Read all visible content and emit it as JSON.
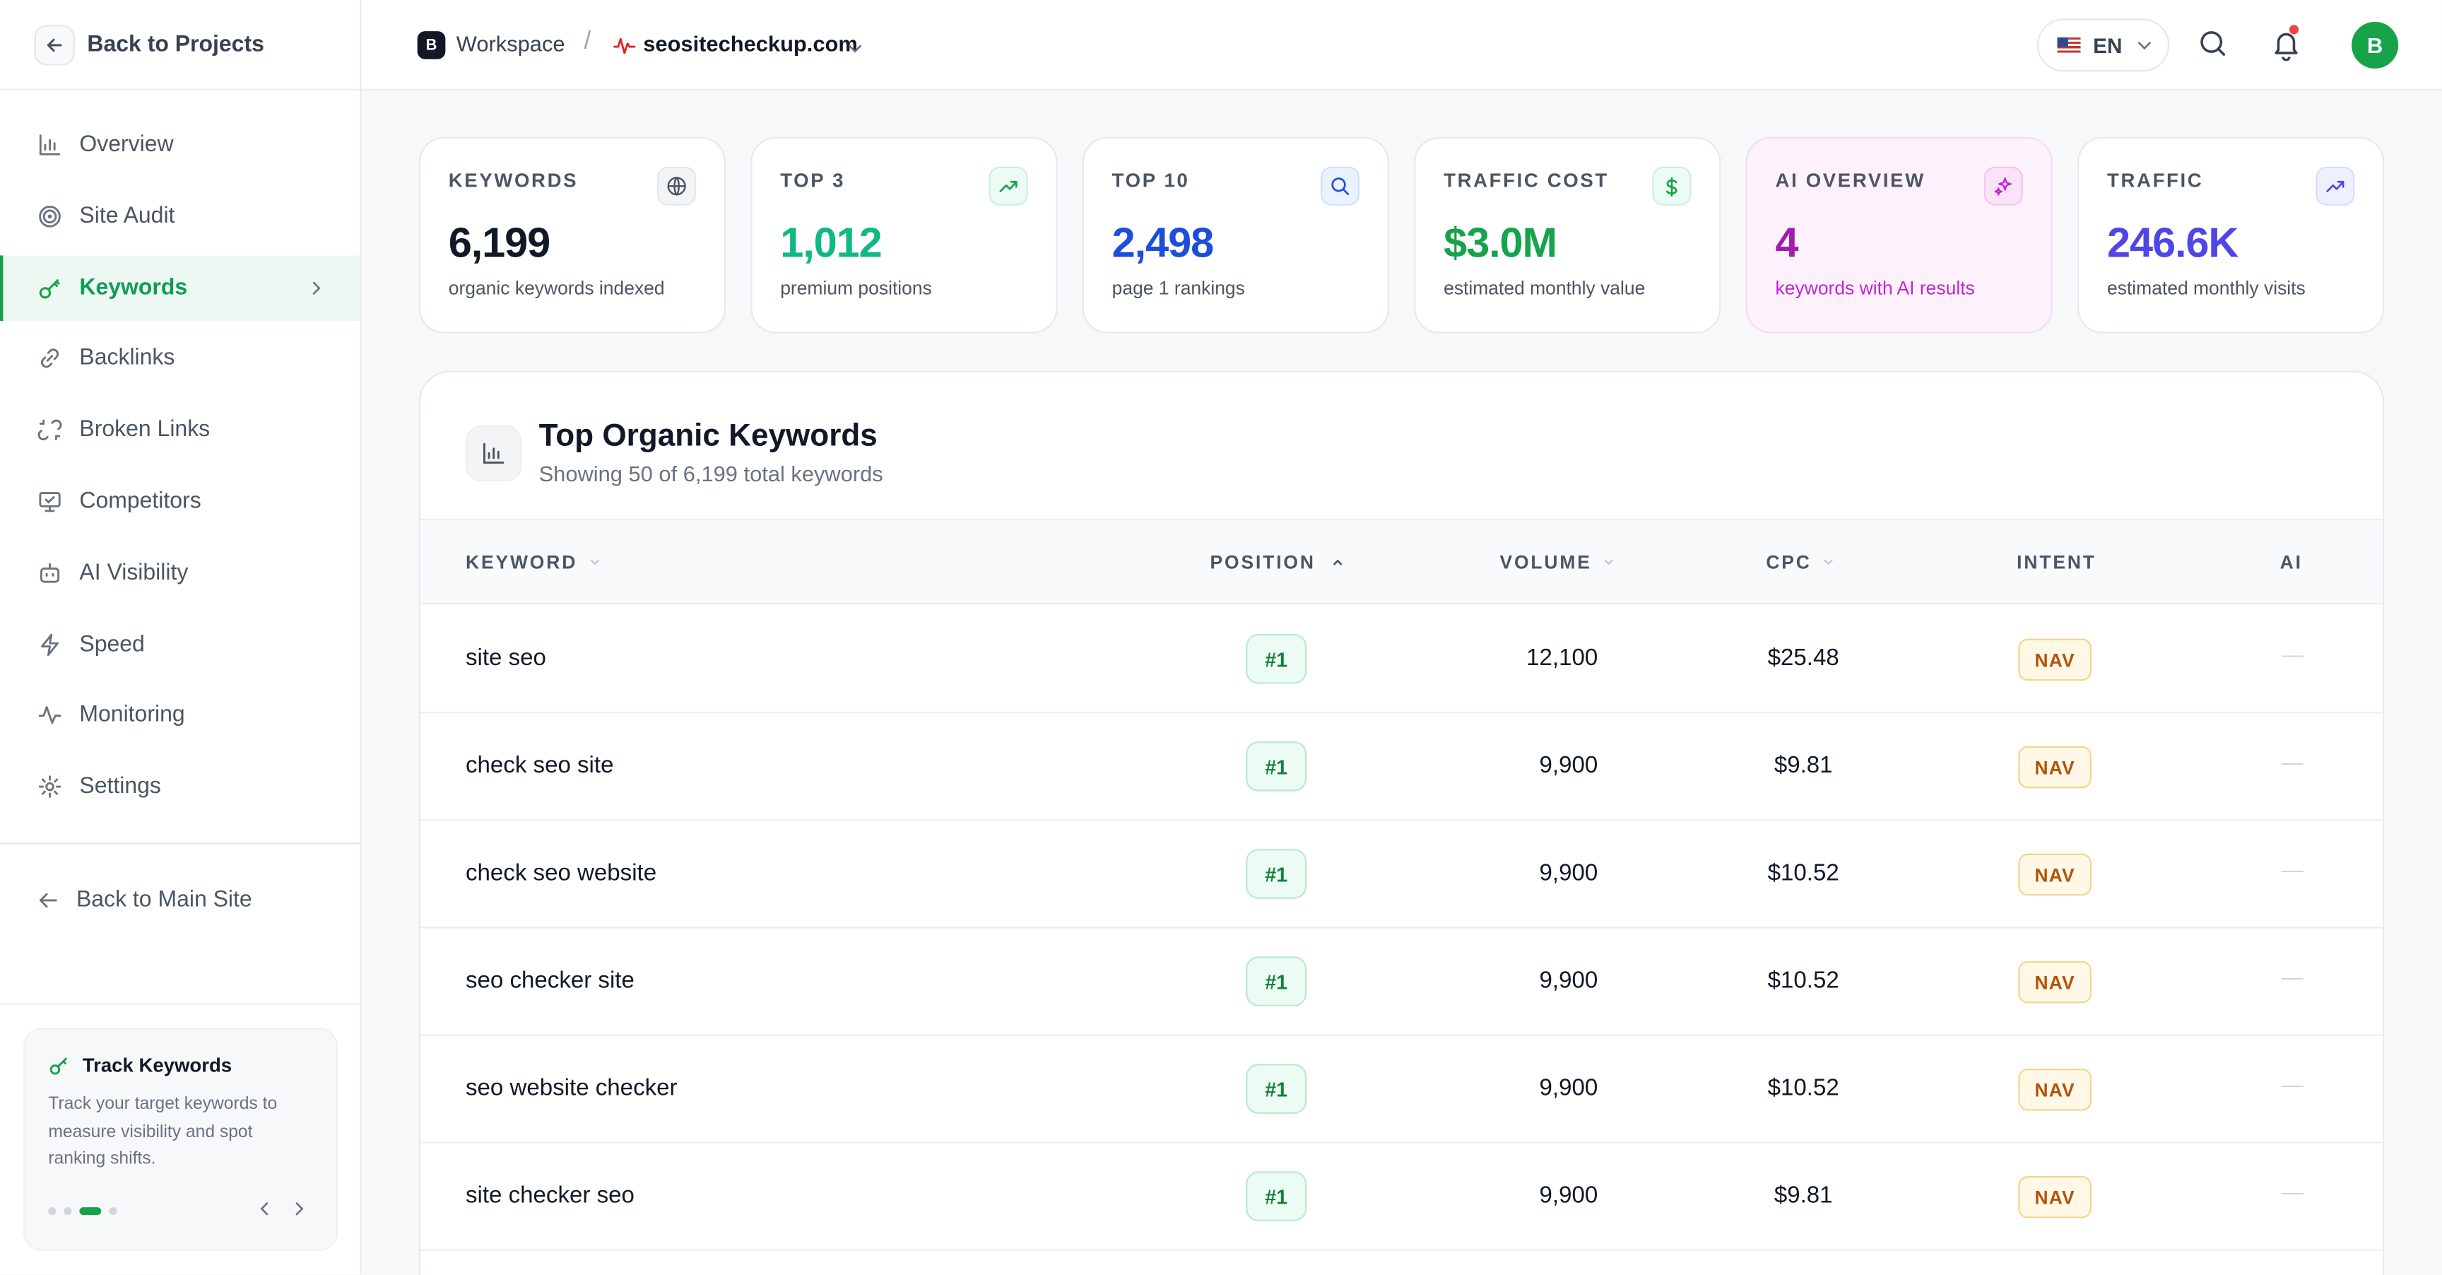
{
  "sidebar": {
    "back_projects": "Back to Projects",
    "items": [
      {
        "label": "Overview",
        "icon": "bar-chart-icon"
      },
      {
        "label": "Site Audit",
        "icon": "target-icon"
      },
      {
        "label": "Keywords",
        "icon": "key-icon",
        "active": true
      },
      {
        "label": "Backlinks",
        "icon": "link-icon"
      },
      {
        "label": "Broken Links",
        "icon": "broken-link-icon"
      },
      {
        "label": "Competitors",
        "icon": "monitor-icon"
      },
      {
        "label": "AI Visibility",
        "icon": "bot-icon"
      },
      {
        "label": "Speed",
        "icon": "lightning-icon"
      },
      {
        "label": "Monitoring",
        "icon": "activity-icon"
      },
      {
        "label": "Settings",
        "icon": "gear-icon"
      }
    ],
    "back_main": "Back to Main Site",
    "track_card": {
      "title": "Track Keywords",
      "body": "Track your target keywords to measure visibility and spot ranking shifts."
    }
  },
  "topbar": {
    "workspace_badge": "B",
    "workspace": "Workspace",
    "separator": "/",
    "site": "seositecheckup.com",
    "language": "EN",
    "avatar": "B"
  },
  "stats": [
    {
      "title": "KEYWORDS",
      "value": "6,199",
      "desc": "organic keywords indexed",
      "color": "#111827"
    },
    {
      "title": "TOP 3",
      "value": "1,012",
      "desc": "premium positions",
      "color": "#10b981"
    },
    {
      "title": "TOP 10",
      "value": "2,498",
      "desc": "page 1 rankings",
      "color": "#1d4ed8"
    },
    {
      "title": "TRAFFIC COST",
      "value": "$3.0M",
      "desc": "estimated monthly value",
      "color": "#16a34a"
    },
    {
      "title": "AI OVERVIEW",
      "value": "4",
      "desc": "keywords with AI results",
      "color": "#a21caf"
    },
    {
      "title": "TRAFFIC",
      "value": "246.6K",
      "desc": "estimated monthly visits",
      "color": "#4f46e5"
    }
  ],
  "table": {
    "title": "Top Organic Keywords",
    "subtitle": "Showing 50 of 6,199 total keywords",
    "columns": {
      "keyword": "KEYWORD",
      "position": "POSITION",
      "volume": "VOLUME",
      "cpc": "CPC",
      "intent": "INTENT",
      "ai": "AI"
    },
    "rows": [
      {
        "keyword": "site seo",
        "position": "#1",
        "volume": "12,100",
        "cpc": "$25.48",
        "intent": "NAV",
        "ai": "—"
      },
      {
        "keyword": "check seo site",
        "position": "#1",
        "volume": "9,900",
        "cpc": "$9.81",
        "intent": "NAV",
        "ai": "—"
      },
      {
        "keyword": "check seo website",
        "position": "#1",
        "volume": "9,900",
        "cpc": "$10.52",
        "intent": "NAV",
        "ai": "—"
      },
      {
        "keyword": "seo checker site",
        "position": "#1",
        "volume": "9,900",
        "cpc": "$10.52",
        "intent": "NAV",
        "ai": "—"
      },
      {
        "keyword": "seo website checker",
        "position": "#1",
        "volume": "9,900",
        "cpc": "$10.52",
        "intent": "NAV",
        "ai": "—"
      },
      {
        "keyword": "site checker seo",
        "position": "#1",
        "volume": "9,900",
        "cpc": "$9.81",
        "intent": "NAV",
        "ai": "—"
      }
    ]
  }
}
